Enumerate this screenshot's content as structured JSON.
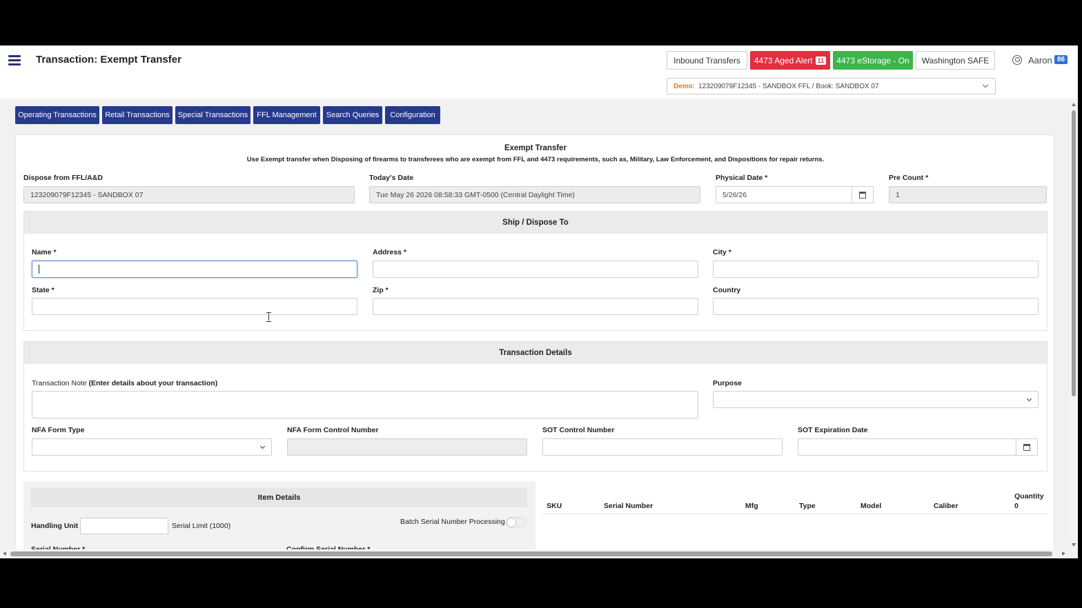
{
  "header": {
    "title": "Transaction: Exempt Transfer",
    "buttons": {
      "inbound": "Inbound Transfers",
      "aged_alert": "4473 Aged Alert",
      "aged_alert_count": "11",
      "estorage": "4473 eStorage - On",
      "washington": "Washington SAFE"
    },
    "user": {
      "name": "Aaron",
      "badge": "86"
    },
    "demo": {
      "label": "Demo:",
      "value": "123209079F12345 - SANDBOX FFL / Book: SANDBOX 07"
    }
  },
  "nav_tabs": [
    "Operating Transactions",
    "Retail Transactions",
    "Special Transactions",
    "FFL Management",
    "Search Queries",
    "Configuration"
  ],
  "form": {
    "title": "Exempt Transfer",
    "description": "Use Exempt transfer when Disposing of firearms to transferees who are exempt from FFL and 4473 requirements, such as, Military, Law Enforcement, and Dispositions for repair returns.",
    "dispose_from": {
      "label": "Dispose from FFL/A&D",
      "value": "123209079F12345 - SANDBOX 07"
    },
    "todays_date": {
      "label": "Today's Date",
      "value": "Tue May 26 2026 08:58:33 GMT-0500 (Central Daylight Time)"
    },
    "physical_date": {
      "label": "Physical Date *",
      "value": "5/26/26"
    },
    "pre_count": {
      "label": "Pre Count *",
      "value": "1"
    }
  },
  "ship_section": {
    "title": "Ship / Dispose To",
    "name": {
      "label": "Name *",
      "value": ""
    },
    "address": {
      "label": "Address *",
      "value": ""
    },
    "city": {
      "label": "City *",
      "value": ""
    },
    "state": {
      "label": "State *",
      "value": ""
    },
    "zip": {
      "label": "Zip *",
      "value": ""
    },
    "country": {
      "label": "Country",
      "value": ""
    }
  },
  "transaction_section": {
    "title": "Transaction Details",
    "note_label": "Transaction Note",
    "note_hint": "(Enter details about your transaction)",
    "purpose_label": "Purpose",
    "nfa_form_type_label": "NFA Form Type",
    "nfa_control_label": "NFA Form Control Number",
    "sot_control_label": "SOT Control Number",
    "sot_expiration_label": "SOT Expiration Date"
  },
  "item_section": {
    "title": "Item Details",
    "handling_unit_label": "Handling Unit",
    "serial_limit": "Serial Limit (1000)",
    "batch_label": "Batch Serial Number Processing",
    "serial_number_label": "Serial Number *",
    "confirm_serial_label": "Confirm Serial Number *"
  },
  "items_table": {
    "columns": [
      "SKU",
      "Serial Number",
      "Mfg",
      "Type",
      "Model",
      "Caliber"
    ],
    "quantity_label": "Quantity",
    "quantity_value": "0"
  },
  "colors": {
    "nav_tab": "#263a8d",
    "aged_alert": "#e0303f",
    "estorage": "#3cb54a",
    "user_badge": "#2f72d9",
    "demo_label": "#e27a24"
  }
}
